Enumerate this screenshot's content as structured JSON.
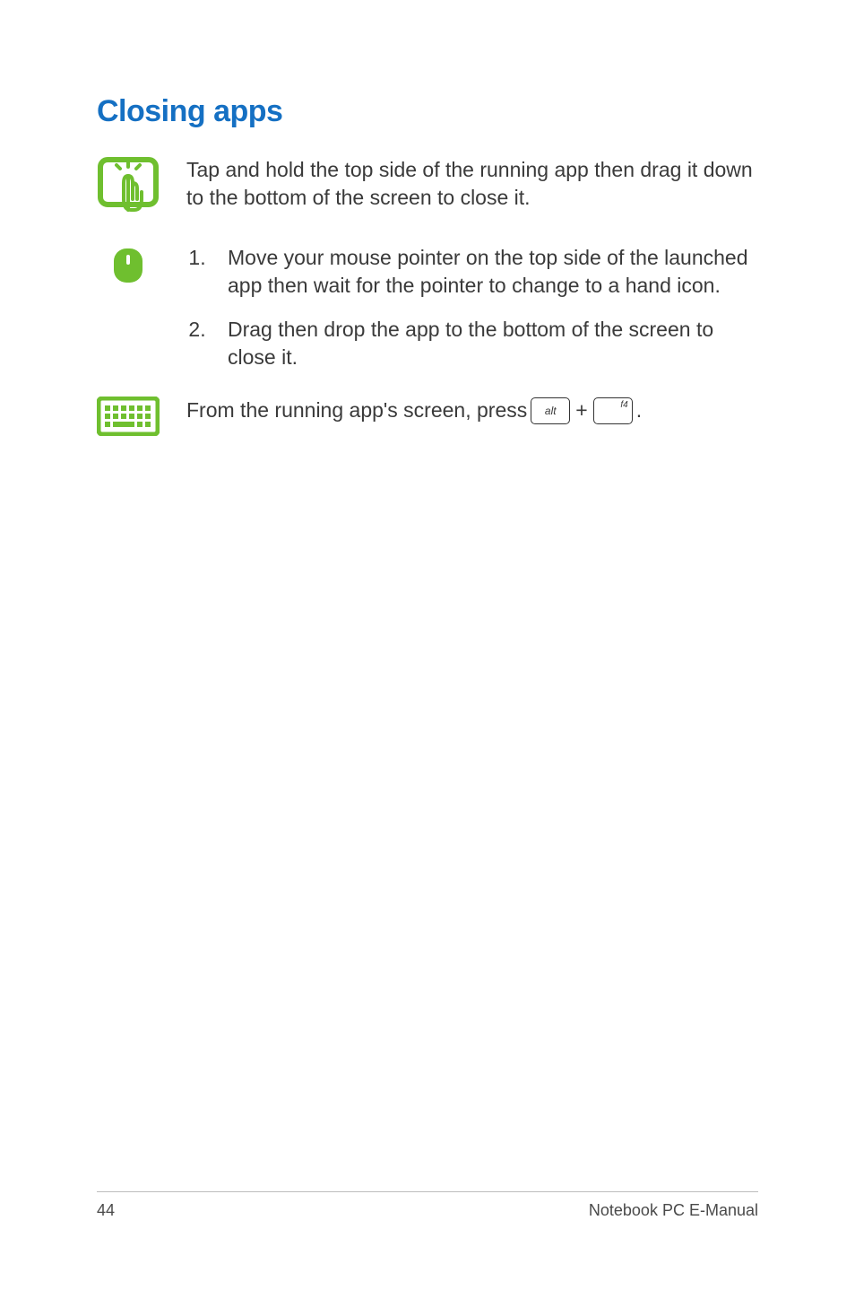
{
  "heading": "Closing apps",
  "touch": {
    "text": "Tap and hold the top side of the running app then drag it down to the bottom of the screen to close it."
  },
  "mouse": {
    "steps": [
      "Move your mouse pointer on the top side of the launched app then wait for the pointer to change to a hand icon.",
      "Drag then drop the app to the bottom of the screen to close it."
    ]
  },
  "keyboard": {
    "prefix": "From the running app's screen, press ",
    "key1": "alt",
    "plus": "+",
    "key2": "f4",
    "suffix": "."
  },
  "footer": {
    "page": "44",
    "doc": "Notebook PC E-Manual"
  }
}
